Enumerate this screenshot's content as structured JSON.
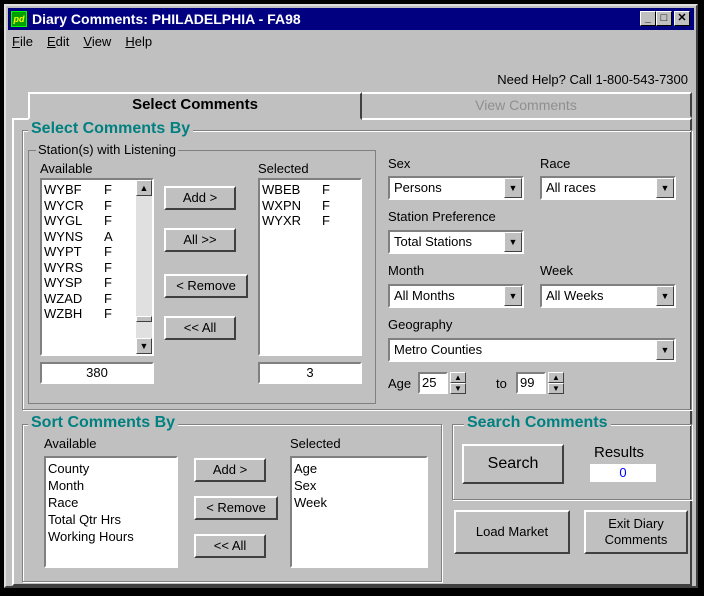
{
  "window": {
    "title": "Diary Comments: PHILADELPHIA - FA98",
    "app_icon": "pd"
  },
  "menu": [
    {
      "label": "File",
      "hotkey": "F",
      "rest": "ile"
    },
    {
      "label": "Edit",
      "hotkey": "E",
      "rest": "dit"
    },
    {
      "label": "View",
      "hotkey": "V",
      "rest": "iew"
    },
    {
      "label": "Help",
      "hotkey": "H",
      "rest": "elp"
    }
  ],
  "help_text": "Need Help?  Call 1-800-543-7300",
  "tabs": {
    "active": "Select Comments",
    "inactive": "View Comments"
  },
  "select_group": {
    "title": "Select Comments By",
    "stations_title": "Station(s) with Listening",
    "available_label": "Available",
    "selected_label": "Selected",
    "available": [
      {
        "call": "WYBF",
        "type": "F"
      },
      {
        "call": "WYCR",
        "type": "F"
      },
      {
        "call": "WYGL",
        "type": "F"
      },
      {
        "call": "WYNS",
        "type": "A"
      },
      {
        "call": "WYPT",
        "type": "F"
      },
      {
        "call": "WYRS",
        "type": "F"
      },
      {
        "call": "WYSP",
        "type": "F"
      },
      {
        "call": "WZAD",
        "type": "F"
      },
      {
        "call": "WZBH",
        "type": "F"
      }
    ],
    "selected": [
      {
        "call": "WBEB",
        "type": "F"
      },
      {
        "call": "WXPN",
        "type": "F"
      },
      {
        "call": "WYXR",
        "type": "F"
      }
    ],
    "available_count": "380",
    "selected_count": "3",
    "buttons": {
      "add": "Add >",
      "all": "All >>",
      "remove": "< Remove",
      "remove_all": "<< All"
    }
  },
  "filters": {
    "sex_label": "Sex",
    "sex_value": "Persons",
    "race_label": "Race",
    "race_value": "All races",
    "pref_label": "Station Preference",
    "pref_value": "Total Stations",
    "month_label": "Month",
    "month_value": "All Months",
    "week_label": "Week",
    "week_value": "All Weeks",
    "geo_label": "Geography",
    "geo_value": "Metro Counties",
    "age_label": "Age",
    "age_from": "25",
    "age_to_label": "to",
    "age_to": "99"
  },
  "sort_group": {
    "title": "Sort Comments By",
    "available_label": "Available",
    "selected_label": "Selected",
    "available": [
      "County",
      "Month",
      "Race",
      "Total Qtr Hrs",
      "Working Hours"
    ],
    "selected": [
      "Age",
      "Sex",
      "Week"
    ],
    "buttons": {
      "add": "Add >",
      "remove": "< Remove",
      "remove_all": "<< All"
    }
  },
  "search_group": {
    "title": "Search Comments",
    "search_button": "Search",
    "results_label": "Results",
    "results_value": "0"
  },
  "bottom_buttons": {
    "load": "Load Market",
    "exit": "Exit Diary Comments"
  },
  "colors": {
    "title_bar": "#000080",
    "group_title": "#008080",
    "results_text": "#0000ff",
    "face": "#c0c0c0"
  }
}
